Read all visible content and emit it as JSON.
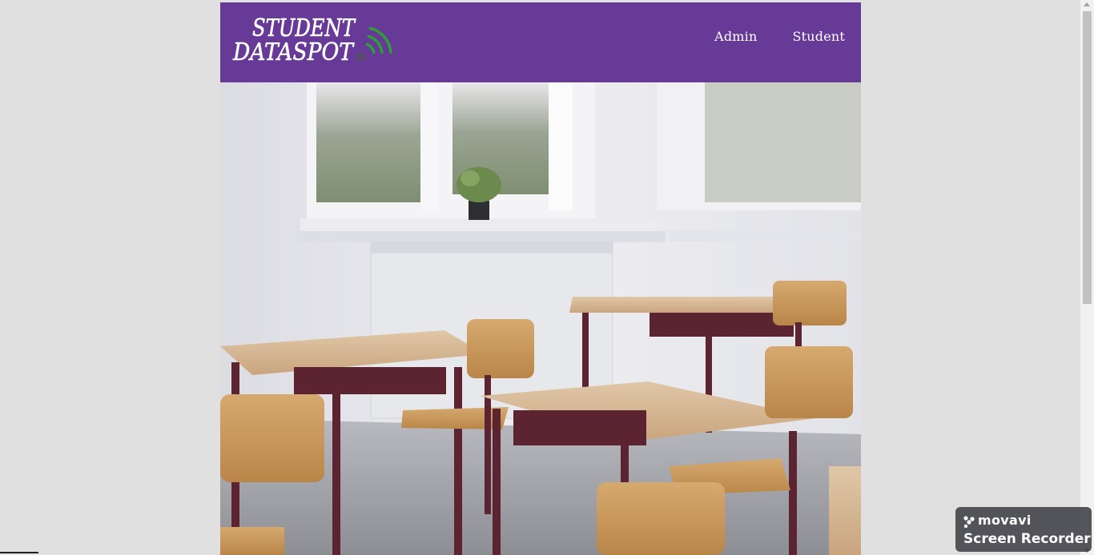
{
  "header": {
    "logo_line1": "STUDENT",
    "logo_line2": "DATASPOT",
    "nav": [
      {
        "label": "Admin"
      },
      {
        "label": "Student"
      }
    ]
  },
  "colors": {
    "header_bg": "#673a97",
    "logo_signal": "#2e9e3a",
    "page_bg": "#e0e0e0"
  },
  "hero": {
    "icon": "classroom-photo"
  },
  "watermark": {
    "brand": "movavi",
    "product": "Screen Recorder"
  }
}
